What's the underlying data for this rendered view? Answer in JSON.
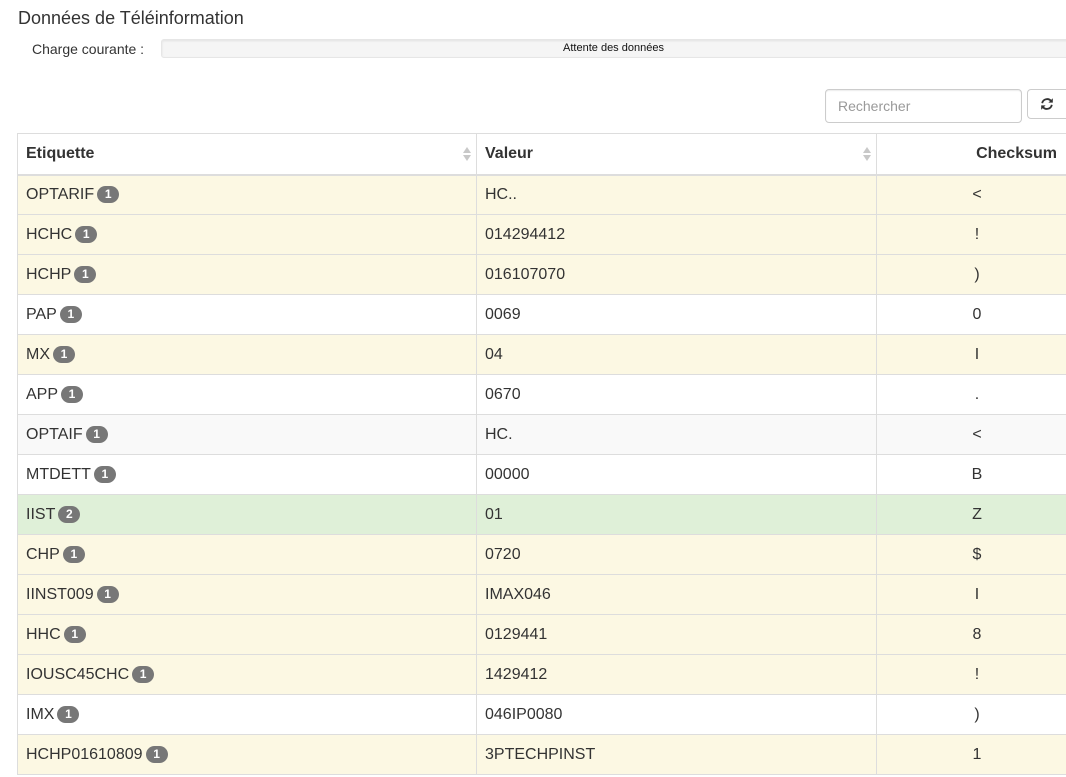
{
  "page": {
    "title": "Données de Téléinformation"
  },
  "charge": {
    "label": "Charge courante :",
    "status_text": "Attente des données",
    "progress": 0
  },
  "search": {
    "placeholder": "Rechercher"
  },
  "toolbar": {
    "refresh_icon": "refresh-icon"
  },
  "table": {
    "headers": [
      "Etiquette",
      "Valeur",
      "Checksum"
    ],
    "rows": [
      {
        "etiquette": "OPTARIF",
        "count": "1",
        "valeur": "HC..",
        "checksum": "<",
        "state": "warning"
      },
      {
        "etiquette": "HCHC",
        "count": "1",
        "valeur": "014294412",
        "checksum": "!",
        "state": "warning"
      },
      {
        "etiquette": "HCHP",
        "count": "1",
        "valeur": "016107070",
        "checksum": ")",
        "state": "warning"
      },
      {
        "etiquette": "PAP",
        "count": "1",
        "valeur": "0069",
        "checksum": "0",
        "state": "plain"
      },
      {
        "etiquette": "MX",
        "count": "1",
        "valeur": "04",
        "checksum": "I",
        "state": "warning"
      },
      {
        "etiquette": "APP",
        "count": "1",
        "valeur": "0670",
        "checksum": ".",
        "state": "plain"
      },
      {
        "etiquette": "OPTAIF",
        "count": "1",
        "valeur": "HC.",
        "checksum": "<",
        "state": "striped"
      },
      {
        "etiquette": "MTDETT",
        "count": "1",
        "valeur": "00000",
        "checksum": "B",
        "state": "plain"
      },
      {
        "etiquette": "IIST",
        "count": "2",
        "valeur": "01",
        "checksum": "Z",
        "state": "success"
      },
      {
        "etiquette": "CHP",
        "count": "1",
        "valeur": "0720",
        "checksum": "$",
        "state": "warning"
      },
      {
        "etiquette": "IINST009",
        "count": "1",
        "valeur": "IMAX046",
        "checksum": "I",
        "state": "warning"
      },
      {
        "etiquette": "HHC",
        "count": "1",
        "valeur": "0129441",
        "checksum": "8",
        "state": "warning"
      },
      {
        "etiquette": "IOUSC45CHC",
        "count": "1",
        "valeur": "1429412",
        "checksum": "!",
        "state": "warning"
      },
      {
        "etiquette": "IMX",
        "count": "1",
        "valeur": "046IP0080",
        "checksum": ")",
        "state": "plain"
      },
      {
        "etiquette": "HCHP01610809",
        "count": "1",
        "valeur": "3PTECHPINST",
        "checksum": "1",
        "state": "warning"
      }
    ]
  }
}
